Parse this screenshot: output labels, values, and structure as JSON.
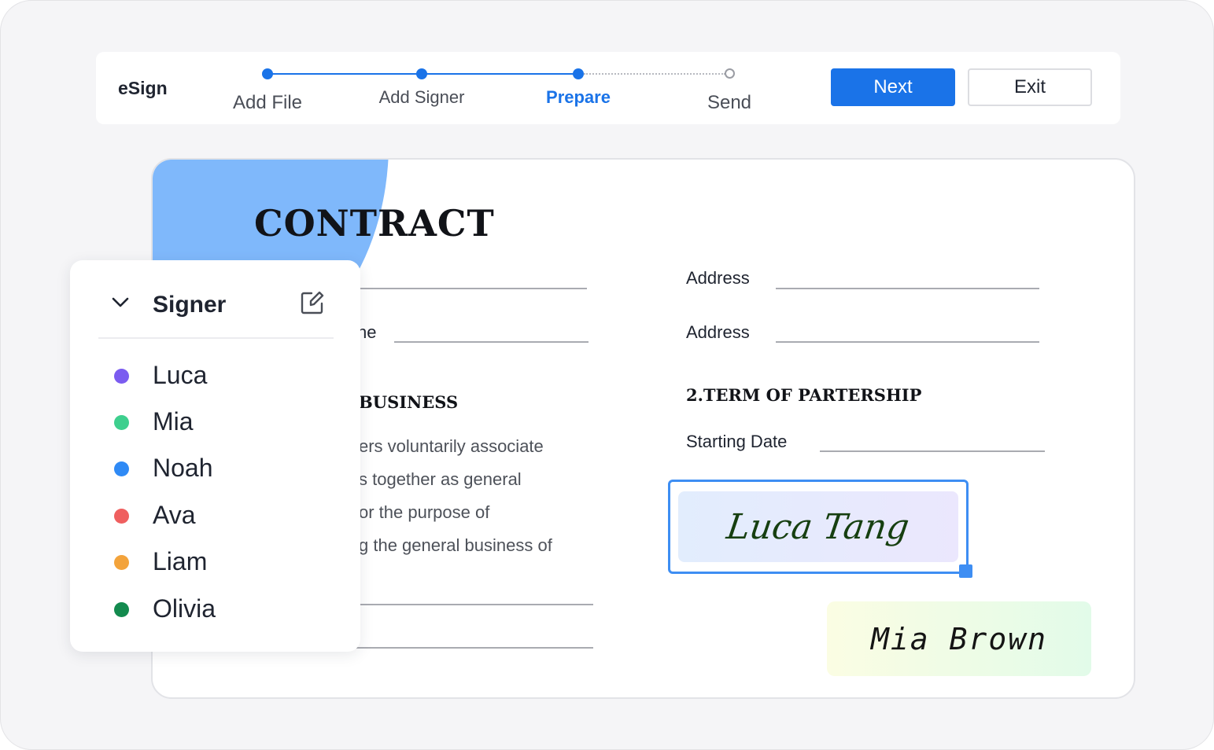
{
  "app": {
    "title": "eSign"
  },
  "steps": [
    {
      "label": "Add File",
      "state": "done"
    },
    {
      "label": "Add Signer",
      "state": "done"
    },
    {
      "label": "Prepare",
      "state": "active"
    },
    {
      "label": "Send",
      "state": "pending"
    }
  ],
  "actions": {
    "next_label": "Next",
    "exit_label": "Exit"
  },
  "document": {
    "title": "CONTRACT",
    "left_field_tail": "ne",
    "right_fields": [
      "Address",
      "Address"
    ],
    "section1_heading_fragment": "BUSINESS",
    "section1_text_lines": [
      "ers voluntarily associate",
      "s together as general",
      "or the purpose of",
      "g the general business of"
    ],
    "section2_heading": "2.TERM OF PARTERSHIP",
    "starting_date_label": "Starting Date",
    "signature_primary": "Luca Tang",
    "signature_secondary": "Mia Brown"
  },
  "signer_panel": {
    "title": "Signer",
    "icons": {
      "collapse": "chevron-down-icon",
      "edit": "edit-icon"
    },
    "signers": [
      {
        "name": "Luca",
        "color": "#7b5cf0"
      },
      {
        "name": "Mia",
        "color": "#3ecf8e"
      },
      {
        "name": "Noah",
        "color": "#2f8af5"
      },
      {
        "name": "Ava",
        "color": "#ef5f5f"
      },
      {
        "name": "Liam",
        "color": "#f3a33b"
      },
      {
        "name": "Olivia",
        "color": "#138a4e"
      }
    ]
  },
  "colors": {
    "accent": "#1a73e8",
    "signature_border": "#3e8ef3",
    "doc_blob": "#7fb8fb"
  }
}
